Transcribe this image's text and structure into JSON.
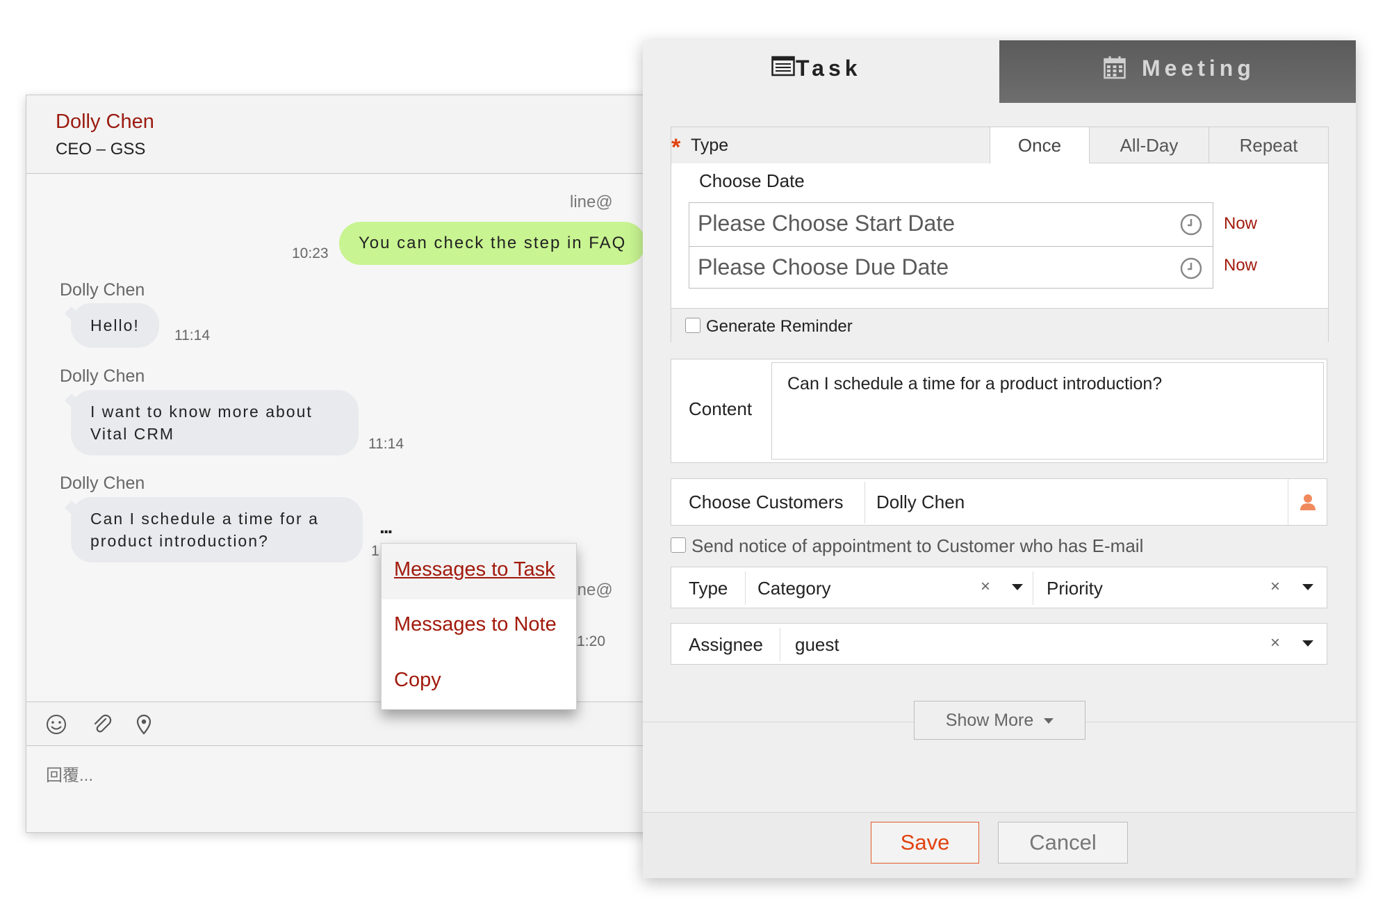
{
  "chat": {
    "contact_name": "Dolly Chen",
    "contact_title": "CEO – GSS",
    "line_source_1": "line@",
    "line_source_2": "line@",
    "outgoing_message": "You can check the step in FAQ",
    "outgoing_time": "10:23",
    "messages": [
      {
        "sender": "Dolly Chen",
        "text": "Hello!",
        "time": "11:14"
      },
      {
        "sender": "Dolly Chen",
        "text": "I want to know more about Vital CRM",
        "time": "11:14"
      },
      {
        "sender": "Dolly Chen",
        "text": "Can I schedule a time for a product introduction?",
        "time": "1"
      }
    ],
    "more_label": "...",
    "later_time": "11:20",
    "reply_placeholder": "回覆..."
  },
  "context_menu": {
    "items": [
      "Messages to Task",
      "Messages to Note",
      "Copy"
    ]
  },
  "dialog": {
    "tabs": [
      {
        "label": "Task",
        "icon": "list-icon",
        "active": true
      },
      {
        "label": "Meeting",
        "icon": "calendar-icon",
        "active": false
      }
    ],
    "type_label": "Type",
    "required_mark": "*",
    "type_options": [
      "Once",
      "All-Day",
      "Repeat"
    ],
    "type_selected": "Once",
    "choose_date_label": "Choose Date",
    "start_placeholder": "Please Choose Start Date",
    "due_placeholder": "Please Choose Due Date",
    "now_label": "Now",
    "reminder_label": "Generate Reminder",
    "reminder_checked": false,
    "content_label": "Content",
    "content_value": "Can I schedule a time for a product introduction?",
    "customers_label": "Choose Customers",
    "customers_value": "Dolly Chen",
    "notice_label": "Send notice of appointment to Customer who has E-mail",
    "notice_checked": false,
    "type_row_label": "Type",
    "category_placeholder": "Category",
    "priority_placeholder": "Priority",
    "clear_symbol": "×",
    "assignee_label": "Assignee",
    "assignee_value": "guest",
    "show_more_label": "Show More",
    "save_label": "Save",
    "cancel_label": "Cancel"
  },
  "colors": {
    "accent_red": "#a11a0c",
    "accent_orange": "#e1420f",
    "outgoing_bubble": "#c8f491",
    "incoming_bubble": "#e8eaed",
    "meeting_tab": "#5b5b5b"
  }
}
